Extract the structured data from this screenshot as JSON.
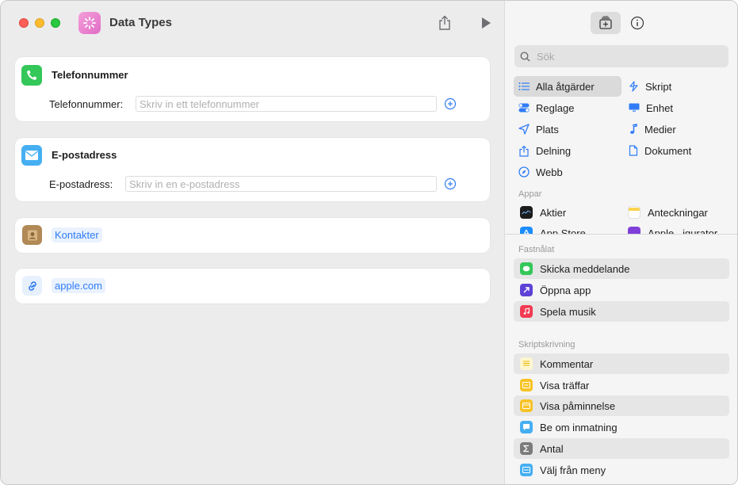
{
  "window": {
    "title": "Data Types"
  },
  "cards": {
    "phone": {
      "title": "Telefonnummer",
      "field_label": "Telefonnummer:",
      "placeholder": "Skriv in ett telefonnummer"
    },
    "email": {
      "title": "E-postadress",
      "field_label": "E-postadress:",
      "placeholder": "Skriv in en e-postadress"
    },
    "contacts": {
      "token": "Kontakter"
    },
    "url": {
      "token": "apple.com"
    }
  },
  "sidebar": {
    "search_placeholder": "Sök",
    "categories": [
      {
        "label": "Alla åtgärder",
        "icon": "list-icon"
      },
      {
        "label": "Skript",
        "icon": "script-icon"
      },
      {
        "label": "Reglage",
        "icon": "toggle-icon"
      },
      {
        "label": "Enhet",
        "icon": "monitor-icon"
      },
      {
        "label": "Plats",
        "icon": "location-arrow-icon"
      },
      {
        "label": "Medier",
        "icon": "music-note-icon"
      },
      {
        "label": "Delning",
        "icon": "share-icon"
      },
      {
        "label": "Dokument",
        "icon": "document-icon"
      },
      {
        "label": "Webb",
        "icon": "compass-icon"
      }
    ],
    "apps_label": "Appar",
    "apps": [
      {
        "label": "Aktier",
        "color": "#1c1c1e"
      },
      {
        "label": "Anteckningar",
        "color": "#fbd44e"
      },
      {
        "label": "App Store",
        "color": "#1a8cff"
      },
      {
        "label": "Apple...igurator",
        "color": "#7f3fd9"
      }
    ],
    "pinned_label": "Fastnålat",
    "pinned": [
      {
        "label": "Skicka meddelande",
        "color": "#34c759"
      },
      {
        "label": "Öppna app",
        "color": "#5e42d6"
      },
      {
        "label": "Spela musik",
        "color": "#f23b53"
      }
    ],
    "scripting_label": "Skriptskrivning",
    "scripting": [
      {
        "label": "Kommentar",
        "color": "#f6d44e"
      },
      {
        "label": "Visa träffar",
        "color": "#f7c325"
      },
      {
        "label": "Visa påminnelse",
        "color": "#f7c325"
      },
      {
        "label": "Be om inmatning",
        "color": "#46aff2"
      },
      {
        "label": "Antal",
        "color": "#7b7b7b"
      },
      {
        "label": "Välj från meny",
        "color": "#46aff2"
      }
    ]
  }
}
